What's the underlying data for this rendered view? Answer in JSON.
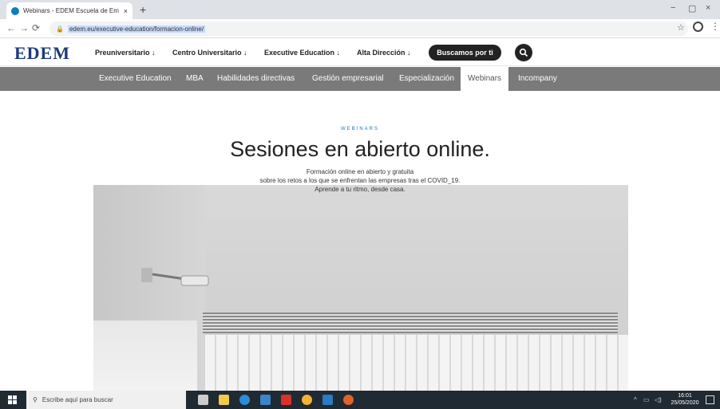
{
  "browser": {
    "tab_title": "Webinars - EDEM Escuela de Em",
    "tab_close": "×",
    "new_tab": "+",
    "url": "edem.eu/executive-education/formacion-online/",
    "win_minimize": "−",
    "win_maximize": "▢",
    "win_close": "×"
  },
  "site": {
    "logo": "EDEM",
    "nav": [
      {
        "label": "Preuniversitario ↓"
      },
      {
        "label": "Centro Universitario ↓"
      },
      {
        "label": "Executive Education ↓"
      },
      {
        "label": "Alta Dirección ↓"
      }
    ],
    "cta": "Buscamos por ti",
    "subnav": [
      {
        "label": "Executive Education"
      },
      {
        "label": "MBA"
      },
      {
        "label": "Habilidades directivas"
      },
      {
        "label": "Gestión empresarial"
      },
      {
        "label": "Especialización"
      },
      {
        "label": "Webinars",
        "active": true
      },
      {
        "label": "Incompany"
      }
    ]
  },
  "hero": {
    "eyebrow": "WEBINARS",
    "title": "Sesiones en abierto online.",
    "line1": "Formación online en abierto y gratuita",
    "line2": "sobre los retos a los que se enfrentan las empresas tras el COVID_19.",
    "line3": "Aprende a tu ritmo, desde casa."
  },
  "taskbar": {
    "search_placeholder": "Escribe aquí para buscar",
    "time": "16:01",
    "date": "25/05/2020"
  },
  "colors": {
    "brand": "#1c3b7a",
    "accent": "#0a7fc2",
    "subnav_bg": "#7a7a7a"
  }
}
